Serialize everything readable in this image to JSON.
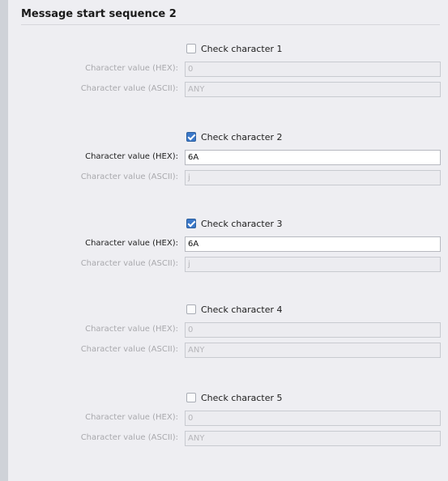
{
  "section": {
    "title": "Message start sequence 2"
  },
  "check_characters": [
    {
      "label": "Check character 1",
      "checked": false,
      "hex_label": "Character value (HEX):",
      "hex_value": "0",
      "ascii_label": "Character value (ASCII):",
      "ascii_value": "ANY",
      "enabled": false
    },
    {
      "label": "Check character 2",
      "checked": true,
      "hex_label": "Character value (HEX):",
      "hex_value": "6A",
      "ascii_label": "Character value (ASCII):",
      "ascii_value": "j",
      "enabled": true
    },
    {
      "label": "Check character 3",
      "checked": true,
      "hex_label": "Character value (HEX):",
      "hex_value": "6A",
      "ascii_label": "Character value (ASCII):",
      "ascii_value": "j",
      "enabled": true
    },
    {
      "label": "Check character 4",
      "checked": false,
      "hex_label": "Character value (HEX):",
      "hex_value": "0",
      "ascii_label": "Character value (ASCII):",
      "ascii_value": "ANY",
      "enabled": false
    },
    {
      "label": "Check character 5",
      "checked": false,
      "hex_label": "Character value (HEX):",
      "hex_value": "0",
      "ascii_label": "Character value (ASCII):",
      "ascii_value": "ANY",
      "enabled": false
    }
  ],
  "colors": {
    "checked": "#3b78c9",
    "disabled_text": "#a9a9ad",
    "panel_bg": "#eeeef2"
  }
}
